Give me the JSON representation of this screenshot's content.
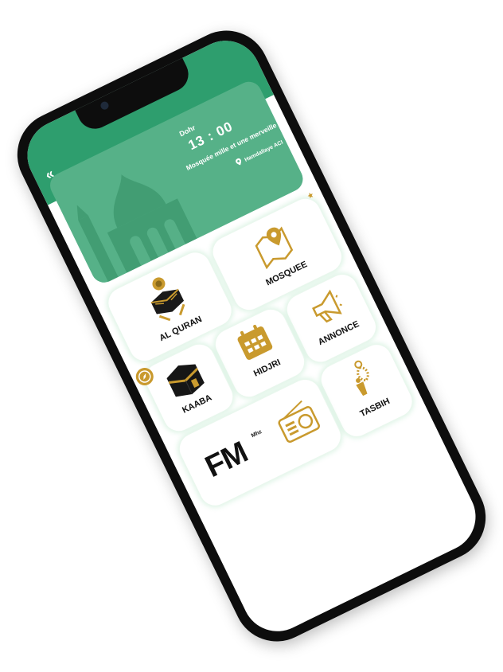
{
  "header": {
    "back_icon": "double-chevron-left-icon",
    "prayer_name": "Dohr",
    "prayer_time": "13 : 00",
    "mosque_name": "Mosquée mille et une merveille",
    "location": "Hamdallaye ACI",
    "location_icon": "map-pin-icon"
  },
  "tiles": {
    "mosque": {
      "label": "MOSQUEE",
      "icon": "map-marker-icon",
      "badge_icon": "crescent-star-icon"
    },
    "quran": {
      "label": "AL QURAN",
      "icon": "quran-book-icon"
    },
    "annonce": {
      "label": "ANNONCE",
      "icon": "megaphone-icon"
    },
    "hidjri": {
      "label": "HIDJRI",
      "icon": "calendar-icon"
    },
    "kaaba": {
      "label": "KAABA",
      "icon": "kaaba-icon",
      "badge_icon": "compass-icon"
    },
    "tasbih": {
      "label": "TASBIH",
      "icon": "prayer-beads-icon"
    },
    "fm": {
      "label": "FM",
      "unit": "Mhz",
      "icon": "radio-icon"
    }
  },
  "colors": {
    "brand_green": "#2e9e6e",
    "card_green": "#56b188",
    "gold": "#c99a2e"
  }
}
